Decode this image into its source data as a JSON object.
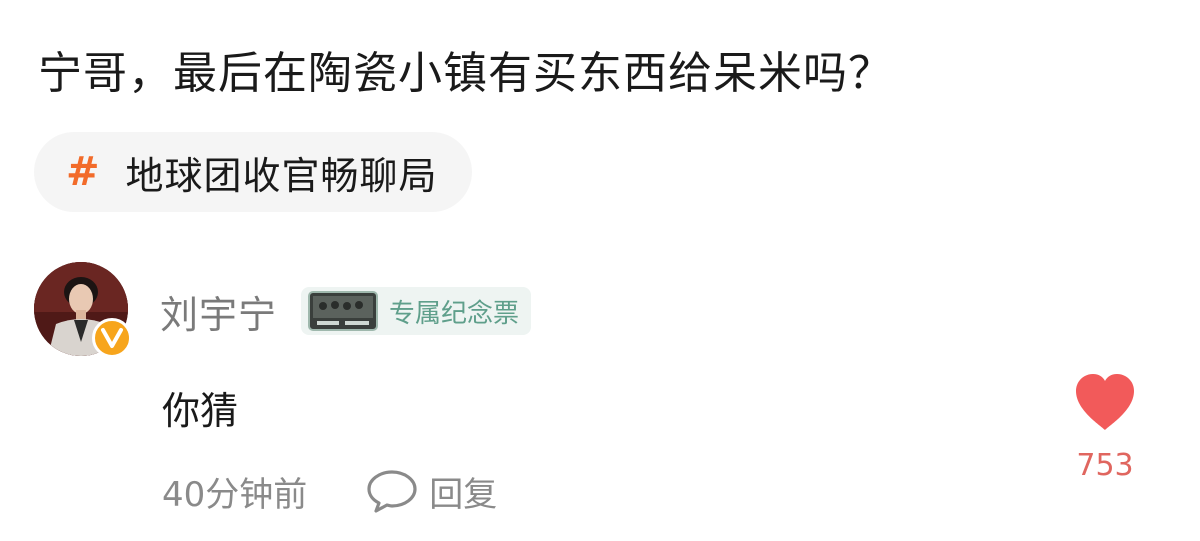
{
  "post": {
    "title": "宁哥，最后在陶瓷小镇有买东西给呆米吗？"
  },
  "topic": {
    "hash": "#",
    "label": "地球团收官畅聊局"
  },
  "comment": {
    "author": "刘宇宁",
    "badge_label": "专属纪念票",
    "text": "你猜",
    "time": "40分钟前",
    "reply_label": "回复",
    "like_count": "753"
  },
  "colors": {
    "topic_hash": "#f26b2a",
    "like_heart": "#f25a5a",
    "badge_text": "#5f9f8b",
    "verified": "#f7a51c"
  },
  "icons": {
    "topic": "hash-icon",
    "verified": "verified-v-icon",
    "reply": "speech-bubble-icon",
    "like": "heart-icon"
  }
}
